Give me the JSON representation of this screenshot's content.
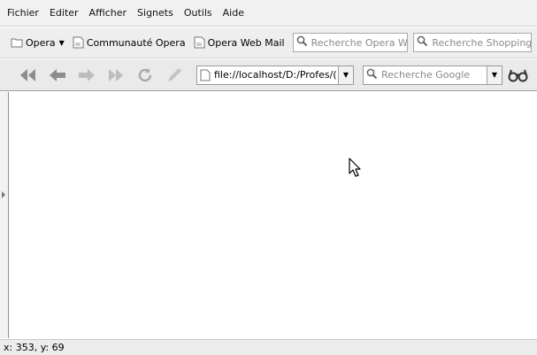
{
  "menu": [
    "Fichier",
    "Editer",
    "Afficher",
    "Signets",
    "Outils",
    "Aide"
  ],
  "bookmarks": {
    "opera": "Opera",
    "communaute": "Communauté Opera",
    "webmail": "Opera Web Mail",
    "search1_placeholder": "Recherche Opera Wi",
    "search2_placeholder": "Recherche Shopping"
  },
  "nav": {
    "address": "file://localhost/D:/Profes/(",
    "search_placeholder": "Recherche Google"
  },
  "status": {
    "coords": "x: 353, y: 69"
  },
  "icons": {
    "rewind": "rewind-icon",
    "back": "back-icon",
    "forward": "forward-icon",
    "fast_forward": "fast-forward-icon",
    "reload": "reload-icon",
    "edit": "edit-icon",
    "page": "page-icon",
    "search": "magnifier-icon",
    "zoom": "glasses-icon",
    "folder": "folder-icon",
    "bookmark": "bookmark-page-icon"
  },
  "colors": {
    "toolbar": "#eeeeee",
    "search_placeholder": "#8a8a8a",
    "content_bg": "#ffffff"
  }
}
